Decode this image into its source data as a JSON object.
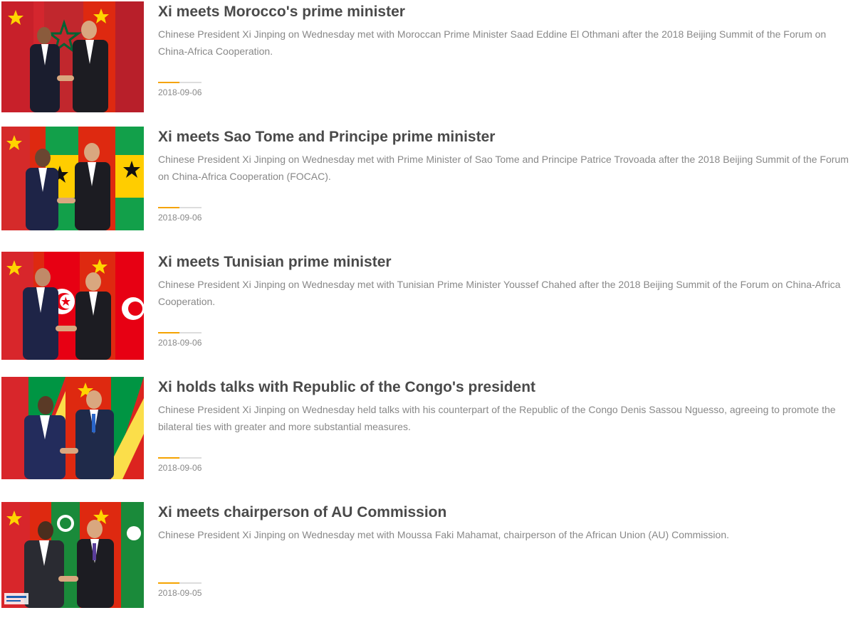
{
  "colors": {
    "headline": "#4a4a4a",
    "summary": "#888888",
    "accent": "#f5a300",
    "divider": "#dddddd"
  },
  "articles": [
    {
      "title": "Xi meets Morocco's prime minister",
      "summary": "Chinese President Xi Jinping on Wednesday met with Moroccan Prime Minister Saad Eddine El Othmani after the 2018 Beijing Summit of the Forum on China-Africa Cooperation.",
      "date": "2018-09-06",
      "image": "photo-xi-morocco-handshake"
    },
    {
      "title": "Xi meets Sao Tome and Principe prime minister",
      "summary": "Chinese President Xi Jinping on Wednesday met with Prime Minister of Sao Tome and Principe Patrice Trovoada after the 2018 Beijing Summit of the Forum on China-Africa Cooperation (FOCAC).",
      "date": "2018-09-06",
      "image": "photo-xi-sao-tome-handshake"
    },
    {
      "title": "Xi meets Tunisian prime minister",
      "summary": "Chinese President Xi Jinping on Wednesday met with Tunisian Prime Minister Youssef Chahed after the 2018 Beijing Summit of the Forum on China-Africa Cooperation.",
      "date": "2018-09-06",
      "image": "photo-xi-tunisia-handshake"
    },
    {
      "title": "Xi holds talks with Republic of the Congo's president",
      "summary": "Chinese President Xi Jinping on Wednesday held talks with his counterpart of the Republic of the Congo Denis Sassou Nguesso, agreeing to promote the bilateral ties with greater and more substantial measures.",
      "date": "2018-09-06",
      "image": "photo-xi-congo-handshake"
    },
    {
      "title": "Xi meets chairperson of AU Commission",
      "summary": "Chinese President Xi Jinping on Wednesday met with Moussa Faki Mahamat, chairperson of the African Union (AU) Commission.",
      "date": "2018-09-05",
      "image": "photo-xi-au-handshake"
    }
  ]
}
